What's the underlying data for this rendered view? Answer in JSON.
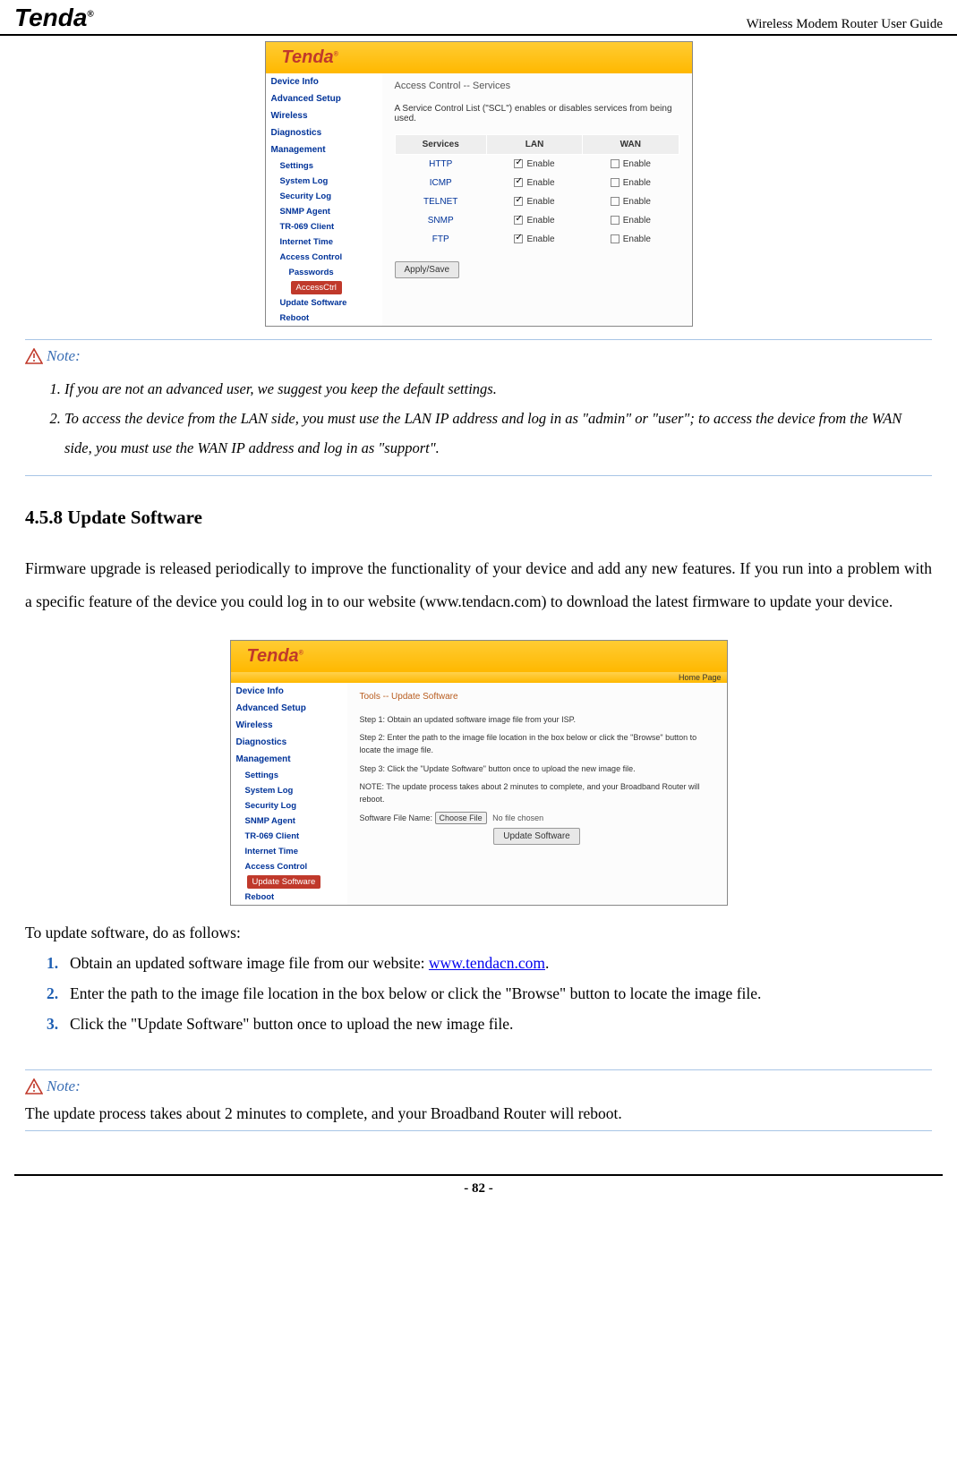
{
  "header": {
    "logo_text": "Tenda",
    "logo_r": "®",
    "title": "Wireless Modem Router User Guide"
  },
  "ss1": {
    "brand": "Tenda",
    "brand_r": "®",
    "nav_main": [
      "Device Info",
      "Advanced Setup",
      "Wireless",
      "Diagnostics",
      "Management"
    ],
    "nav_sub": [
      "Settings",
      "System Log",
      "Security Log",
      "SNMP Agent",
      "TR-069 Client",
      "Internet Time",
      "Access Control"
    ],
    "nav_sub2": "Passwords",
    "nav_active": "AccessCtrl",
    "nav_after": [
      "Update Software",
      "Reboot"
    ],
    "breadcrumb": "Access Control -- Services",
    "desc": "A Service Control List (\"SCL\") enables or disables services from being used.",
    "table": {
      "headers": [
        "Services",
        "LAN",
        "WAN"
      ],
      "rows": [
        {
          "svc": "HTTP",
          "lan": true,
          "wan": false,
          "label": "Enable"
        },
        {
          "svc": "ICMP",
          "lan": true,
          "wan": false,
          "label": "Enable"
        },
        {
          "svc": "TELNET",
          "lan": true,
          "wan": false,
          "label": "Enable"
        },
        {
          "svc": "SNMP",
          "lan": true,
          "wan": false,
          "label": "Enable"
        },
        {
          "svc": "FTP",
          "lan": true,
          "wan": false,
          "label": "Enable"
        }
      ]
    },
    "apply_btn": "Apply/Save"
  },
  "note1": {
    "label": "Note:",
    "items": [
      "If you are not an advanced user, we suggest you keep the default settings.",
      "To access the device from the LAN side, you must use the LAN IP address and log in as \"admin\" or \"user\"; to access the device from the WAN side, you must use the WAN IP address and log in as \"support\"."
    ]
  },
  "section": {
    "heading": "4.5.8 Update Software",
    "para": "Firmware upgrade is released periodically to improve the functionality of your device and add any new features. If you run into a problem with a specific feature of the device you could log in to our website (www.tendacn.com) to download the latest firmware to update your device."
  },
  "ss2": {
    "brand": "Tenda",
    "brand_r": "®",
    "home": "Home Page",
    "nav_main": [
      "Device Info",
      "Advanced Setup",
      "Wireless",
      "Diagnostics",
      "Management"
    ],
    "nav_sub": [
      "Settings",
      "System Log",
      "Security Log",
      "SNMP Agent",
      "TR-069 Client",
      "Internet Time",
      "Access Control"
    ],
    "nav_active": "Update Software",
    "nav_after": [
      "Reboot"
    ],
    "breadcrumb": "Tools -- Update Software",
    "step1": "Step 1: Obtain an updated software image file from your ISP.",
    "step2": "Step 2: Enter the path to the image file location in the box below or click the \"Browse\" button to locate the image file.",
    "step3": "Step 3: Click the \"Update Software\" button once to upload the new image file.",
    "note": "NOTE: The update process takes about 2 minutes to complete, and your Broadband Router will reboot.",
    "file_label": "Software File Name:",
    "choose_btn": "Choose File",
    "no_file": "No file chosen",
    "update_btn": "Update Software"
  },
  "instructions": {
    "intro": "To update software, do as follows:",
    "steps": [
      {
        "pre": "Obtain an updated software image file from our website: ",
        "link": "www.tendacn.com",
        "post": "."
      },
      {
        "text": "Enter the path to the image file location in the box below or click the \"Browse\" button to locate the image file."
      },
      {
        "text": "Click the \"Update Software\" button once to upload the new image file."
      }
    ]
  },
  "note2": {
    "label": "Note:",
    "body": "The update process takes about 2 minutes to complete, and your Broadband Router will reboot."
  },
  "footer": {
    "page": "- 82 -"
  }
}
